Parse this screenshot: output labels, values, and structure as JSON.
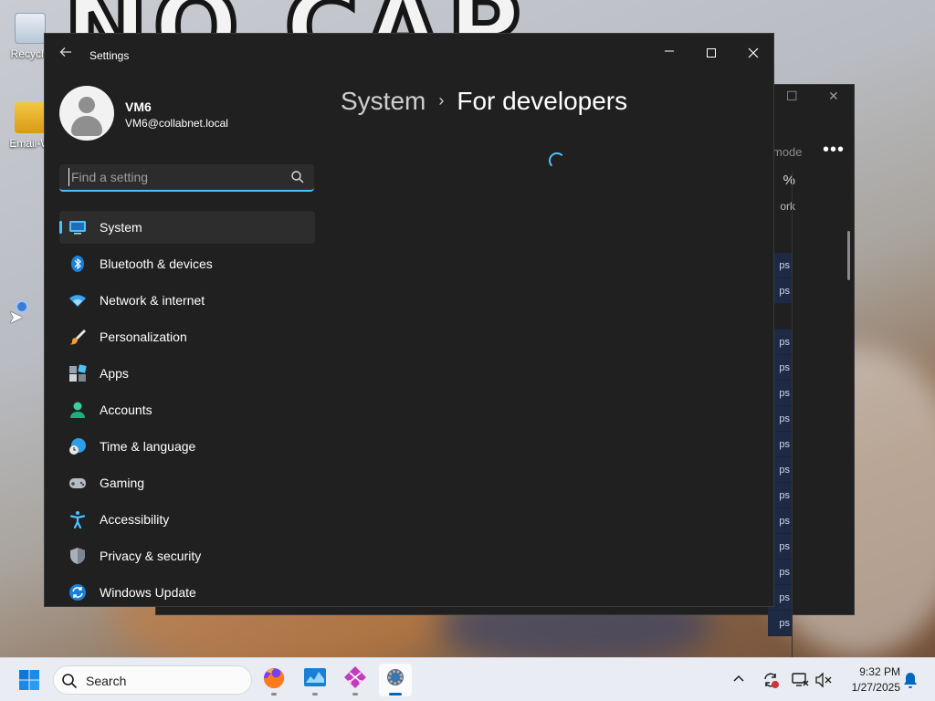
{
  "desktop": {
    "banner": "NO CAP KEYS?",
    "icons": [
      {
        "label": "Recycle"
      },
      {
        "label": "Email-W"
      }
    ]
  },
  "background_window": {
    "mode_label": "mode",
    "column_header": "%",
    "column_sub": "ork",
    "row_value": "ps"
  },
  "settings": {
    "title": "Settings",
    "user": {
      "name": "VM6",
      "email": "VM6@collabnet.local"
    },
    "search": {
      "placeholder": "Find a setting",
      "value": ""
    },
    "nav": [
      {
        "label": "System",
        "icon": "monitor-icon",
        "active": true
      },
      {
        "label": "Bluetooth & devices",
        "icon": "bluetooth-icon"
      },
      {
        "label": "Network & internet",
        "icon": "wifi-icon"
      },
      {
        "label": "Personalization",
        "icon": "brush-icon"
      },
      {
        "label": "Apps",
        "icon": "apps-icon"
      },
      {
        "label": "Accounts",
        "icon": "person-icon"
      },
      {
        "label": "Time & language",
        "icon": "globe-clock-icon"
      },
      {
        "label": "Gaming",
        "icon": "gamepad-icon"
      },
      {
        "label": "Accessibility",
        "icon": "accessibility-icon"
      },
      {
        "label": "Privacy & security",
        "icon": "shield-icon"
      },
      {
        "label": "Windows Update",
        "icon": "update-icon"
      }
    ],
    "breadcrumb": {
      "parent": "System",
      "separator": "›",
      "current": "For developers"
    },
    "accent_color": "#4cc2ff"
  },
  "taskbar": {
    "search_label": "Search",
    "apps": [
      "firefox-icon",
      "task-manager-icon",
      "snipping-tool-icon",
      "settings-icon"
    ],
    "time": "9:32 PM",
    "date": "1/27/2025"
  }
}
